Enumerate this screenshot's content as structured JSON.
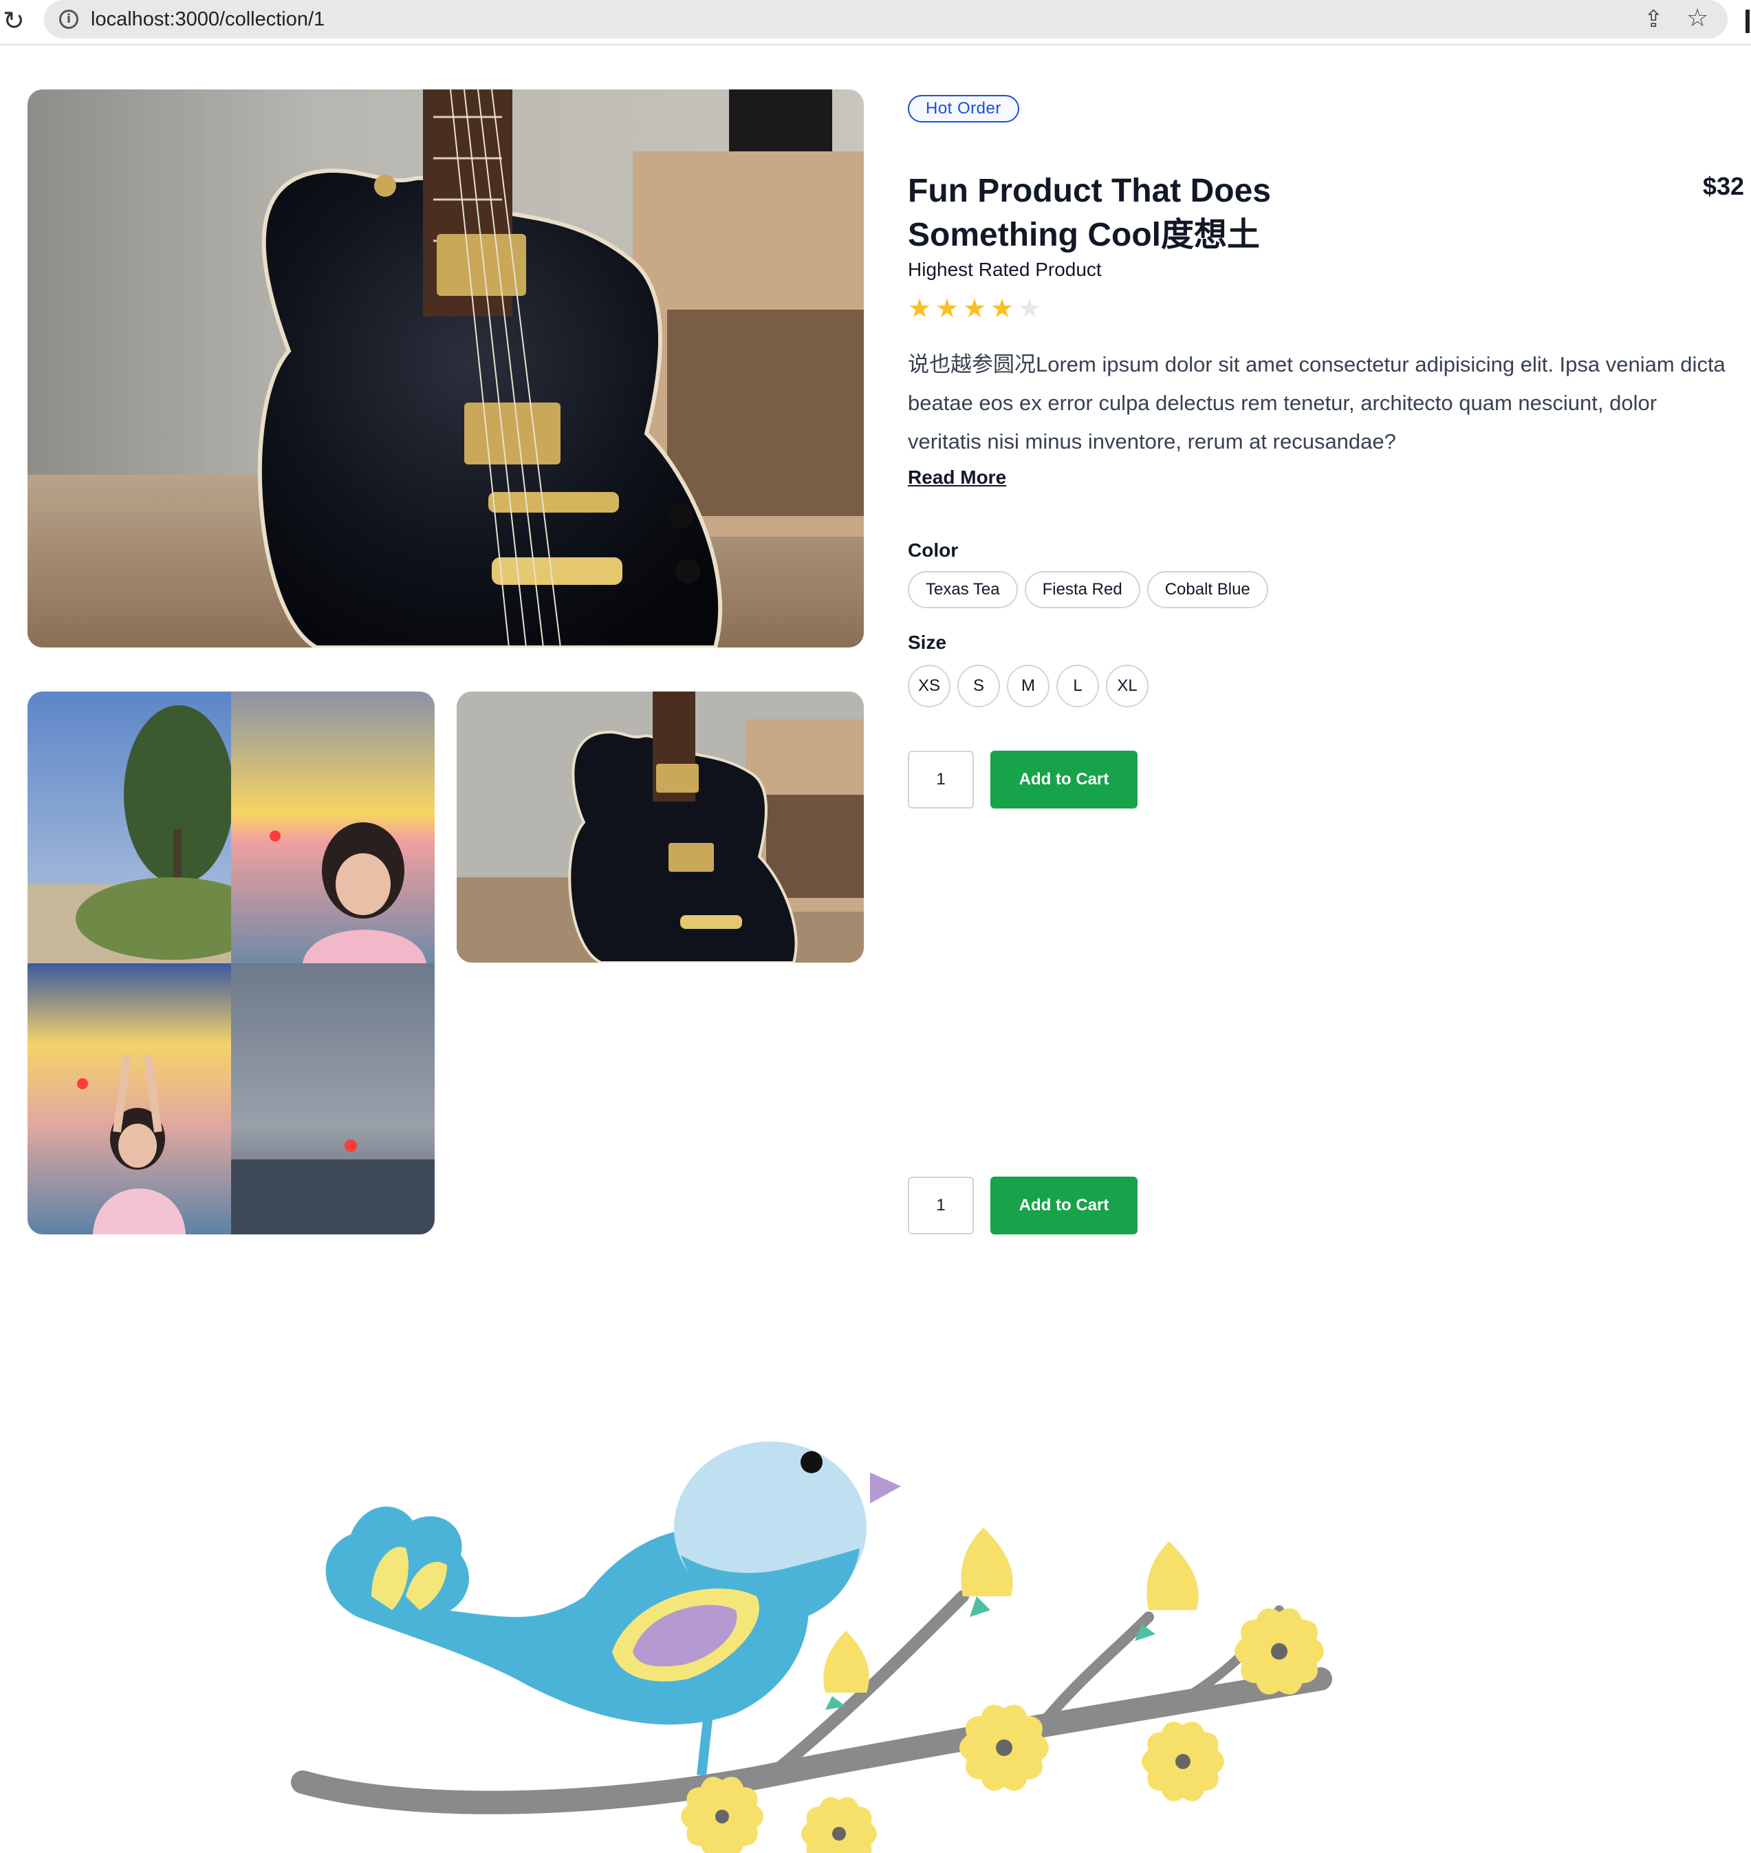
{
  "browser": {
    "url": "localhost:3000/collection/1"
  },
  "product": {
    "badge": "Hot Order",
    "title": "Fun Product That Does Something Cool度想土",
    "price": "$32",
    "subtitle": "Highest Rated Product",
    "rating": 4,
    "rating_max": 5,
    "description": "说也越参圆况Lorem ipsum dolor sit amet consectetur adipisicing elit. Ipsa veniam dicta beatae eos ex error culpa delectus rem tenetur, architecto quam nesciunt, dolor veritatis nisi minus inventore, rerum at recusandae?",
    "read_more": "Read More"
  },
  "options": {
    "color_label": "Color",
    "colors": [
      "Texas Tea",
      "Fiesta Red",
      "Cobalt Blue"
    ],
    "size_label": "Size",
    "sizes": [
      "XS",
      "S",
      "M",
      "L",
      "XL"
    ]
  },
  "cart": {
    "quantity": "1",
    "button_label": "Add to Cart"
  },
  "colors": {
    "accent_green": "#16a34a",
    "badge_blue": "#1d4ed8",
    "star_yellow": "#fbbf24"
  }
}
